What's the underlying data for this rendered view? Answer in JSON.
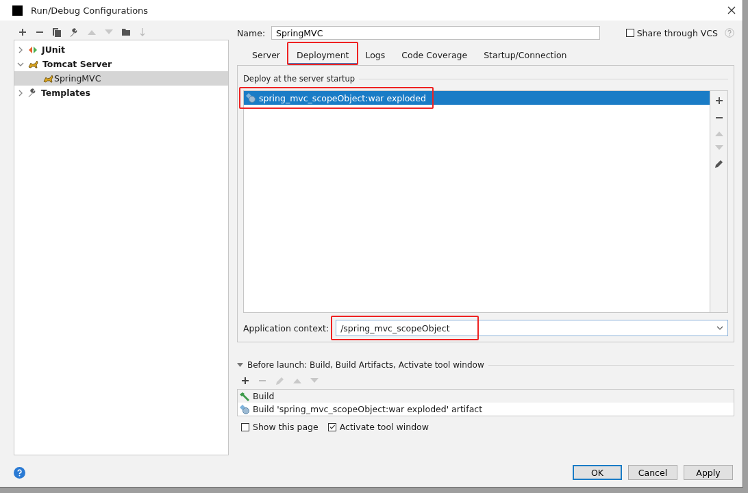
{
  "window": {
    "title": "Run/Debug Configurations"
  },
  "tree": [
    {
      "label": "JUnit",
      "expanded": false,
      "selected": false
    },
    {
      "label": "Tomcat Server",
      "expanded": true,
      "selected": false,
      "children": [
        {
          "label": "SpringMVC",
          "selected": true
        }
      ]
    },
    {
      "label": "Templates",
      "expanded": false,
      "selected": false
    }
  ],
  "name_field": {
    "label": "Name:",
    "value": "SpringMVC"
  },
  "share": {
    "label": "Share through VCS",
    "checked": false
  },
  "tabs": [
    {
      "label": "Server",
      "selected": false,
      "highlighted": false
    },
    {
      "label": "Deployment",
      "selected": true,
      "highlighted": true
    },
    {
      "label": "Logs",
      "selected": false,
      "highlighted": false
    },
    {
      "label": "Code Coverage",
      "selected": false,
      "highlighted": false
    },
    {
      "label": "Startup/Connection",
      "selected": false,
      "highlighted": false
    }
  ],
  "deploy": {
    "title": "Deploy at the server startup",
    "items": [
      {
        "label": "spring_mvc_scopeObject:war exploded",
        "selected": true,
        "highlighted": true
      }
    ]
  },
  "app_context": {
    "label": "Application context:",
    "value": "/spring_mvc_scopeObject",
    "highlighted": true
  },
  "before_launch": {
    "title": "Before launch: Build, Build Artifacts, Activate tool window",
    "expanded": true,
    "items": [
      {
        "kind": "build",
        "label": "Build"
      },
      {
        "kind": "artifact",
        "label": "Build 'spring_mvc_scopeObject:war exploded' artifact"
      }
    ]
  },
  "options": [
    {
      "label": "Show this page",
      "checked": false
    },
    {
      "label": "Activate tool window",
      "checked": true
    }
  ],
  "buttons": [
    {
      "label": "OK",
      "default": true
    },
    {
      "label": "Cancel",
      "default": false
    },
    {
      "label": "Apply",
      "default": false
    }
  ]
}
